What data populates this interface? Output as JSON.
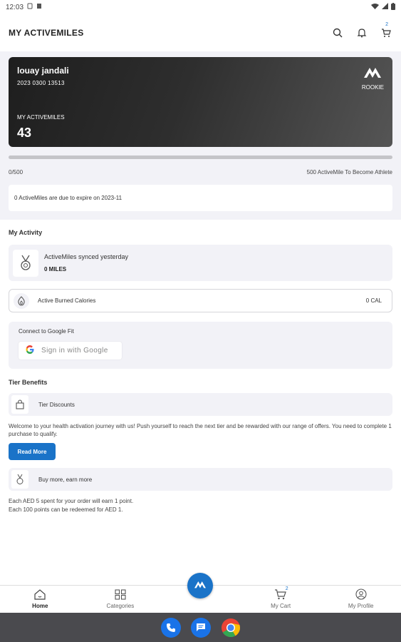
{
  "status_bar": {
    "time": "12:03"
  },
  "header": {
    "title": "MY ACTIVEMILES",
    "cart_count": "2"
  },
  "card": {
    "name": "louay jandali",
    "number": "2023 0300 13513",
    "tier": "ROOKIE",
    "miles_label": "MY ACTIVEMILES",
    "miles_value": "43"
  },
  "progress": {
    "current": "0/500",
    "target_text": "500 ActiveMile To Become Athlete",
    "fraction": 0
  },
  "expiry": {
    "text": "0 ActiveMiles are due to expire on 2023-11"
  },
  "activity": {
    "title": "My Activity",
    "synced_label": "ActiveMiles synced yesterday",
    "synced_value": "0 MILES",
    "calories_label": "Active Burned Calories",
    "calories_value": "0 CAL",
    "google_fit_label": "Connect to Google Fit",
    "google_button": "Sign in with Google"
  },
  "tier_benefits": {
    "title": "Tier Benefits",
    "discounts_label": "Tier Discounts",
    "discounts_text": "Welcome to your health activation journey with us! Push yourself to reach the next tier and be rewarded with our range of offers. You need to complete 1 purchase to qualify.",
    "read_more": "Read More",
    "buy_more_label": "Buy more, earn more",
    "buy_more_line1": "Each AED 5 spent for your order will earn 1 point.",
    "buy_more_line2": "Each 100 points can be redeemed for AED 1."
  },
  "bottom_nav": {
    "home": "Home",
    "categories": "Categories",
    "cart": "My Cart",
    "cart_count": "2",
    "profile": "My Profile"
  },
  "colors": {
    "accent": "#1a73c8",
    "card_dark": "#1e1e1e",
    "panel": "#f2f2f7"
  }
}
